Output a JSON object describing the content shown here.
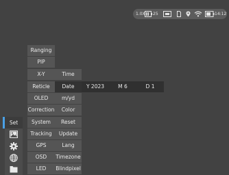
{
  "status_bar": {
    "zoom": "1.0X",
    "battery_level": "25",
    "time": "14:12",
    "icons": [
      "battery-icon",
      "hdmi-icon",
      "sd-card-icon",
      "gps-icon",
      "wifi-icon",
      "battery-level-icon"
    ]
  },
  "sidebar": {
    "items": [
      {
        "label": "Set",
        "icon": "settings-set",
        "active": true
      },
      {
        "label": "",
        "icon": "image-icon"
      },
      {
        "label": "",
        "icon": "gear-icon"
      },
      {
        "label": "",
        "icon": "globe-icon"
      },
      {
        "label": "",
        "icon": "folder-icon"
      }
    ]
  },
  "menu": {
    "col1": [
      "Ranging",
      "PIP",
      "X-Y",
      "Reticle",
      "OLED",
      "Correction",
      "System",
      "Tracking",
      "GPS",
      "OSD",
      "LED"
    ],
    "col2": [
      "Time",
      "Date",
      "m/yd",
      "Color",
      "Reset",
      "Update",
      "Lang",
      "Timezone",
      "Blindpixel"
    ],
    "selected_col1": "System",
    "selected_col2": "Date"
  },
  "date_editor": {
    "year": "Y 2023",
    "month": "M 6",
    "day": "D 1"
  }
}
